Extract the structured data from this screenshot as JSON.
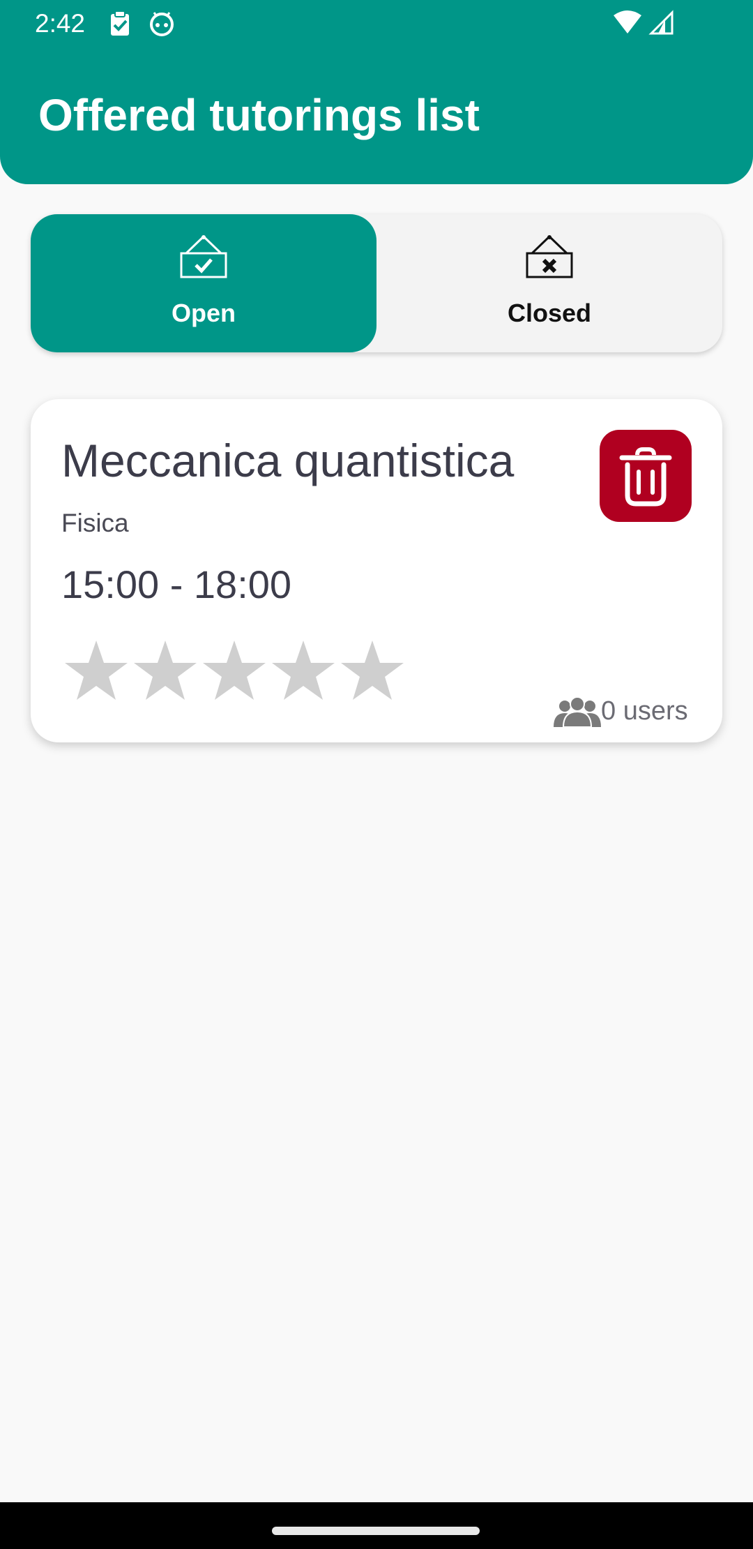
{
  "status_bar": {
    "time": "2:42",
    "left_icons": [
      "clipboard-check-icon",
      "android-face-icon"
    ],
    "right_icons": [
      "wifi-icon",
      "cellular-signal-icon"
    ]
  },
  "header": {
    "title": "Offered tutorings list"
  },
  "toggle": {
    "selected": "open",
    "open": {
      "label": "Open",
      "icon": "open-sign-icon"
    },
    "closed": {
      "label": "Closed",
      "icon": "closed-sign-icon"
    }
  },
  "tutorings": [
    {
      "title": "Meccanica quantistica",
      "subject": "Fisica",
      "time": "15:00 - 18:00",
      "rating": 0,
      "rating_max": 5,
      "users": "0 users",
      "users_icon": "users-group-icon",
      "delete_icon": "trash-icon"
    }
  ],
  "colors": {
    "primary": "#009688",
    "delete": "#b00020",
    "star_inactive": "#cfcfcf",
    "background": "#f9f9f9"
  }
}
